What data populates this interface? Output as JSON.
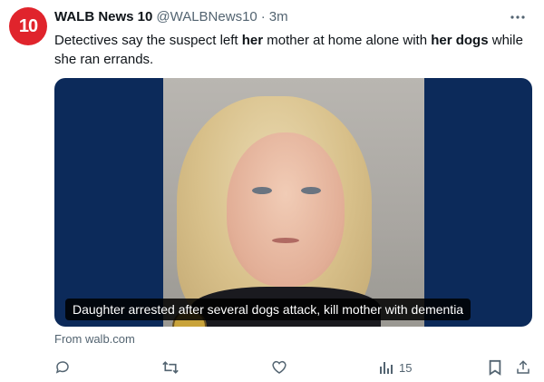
{
  "author": {
    "avatar_text": "10",
    "name": "WALB News 10",
    "handle": "@WALBNews10",
    "separator": "·",
    "time": "3m"
  },
  "text": {
    "p1": "Detectives say the suspect left ",
    "b1": "her",
    "p2": " mother at home alone with ",
    "b2": "her dogs",
    "p3": " while she ran errands."
  },
  "media": {
    "caption": "Daughter arrested after several dogs attack, kill mother with dementia"
  },
  "source": "From walb.com",
  "actions": {
    "views_count": "15"
  },
  "colors": {
    "brand_red": "#e0242c",
    "secondary_text": "#536471",
    "media_bg": "#0c2a5a"
  },
  "icons": [
    "more-icon",
    "reply-icon",
    "retweet-icon",
    "like-icon",
    "views-icon",
    "bookmark-icon",
    "share-icon"
  ]
}
